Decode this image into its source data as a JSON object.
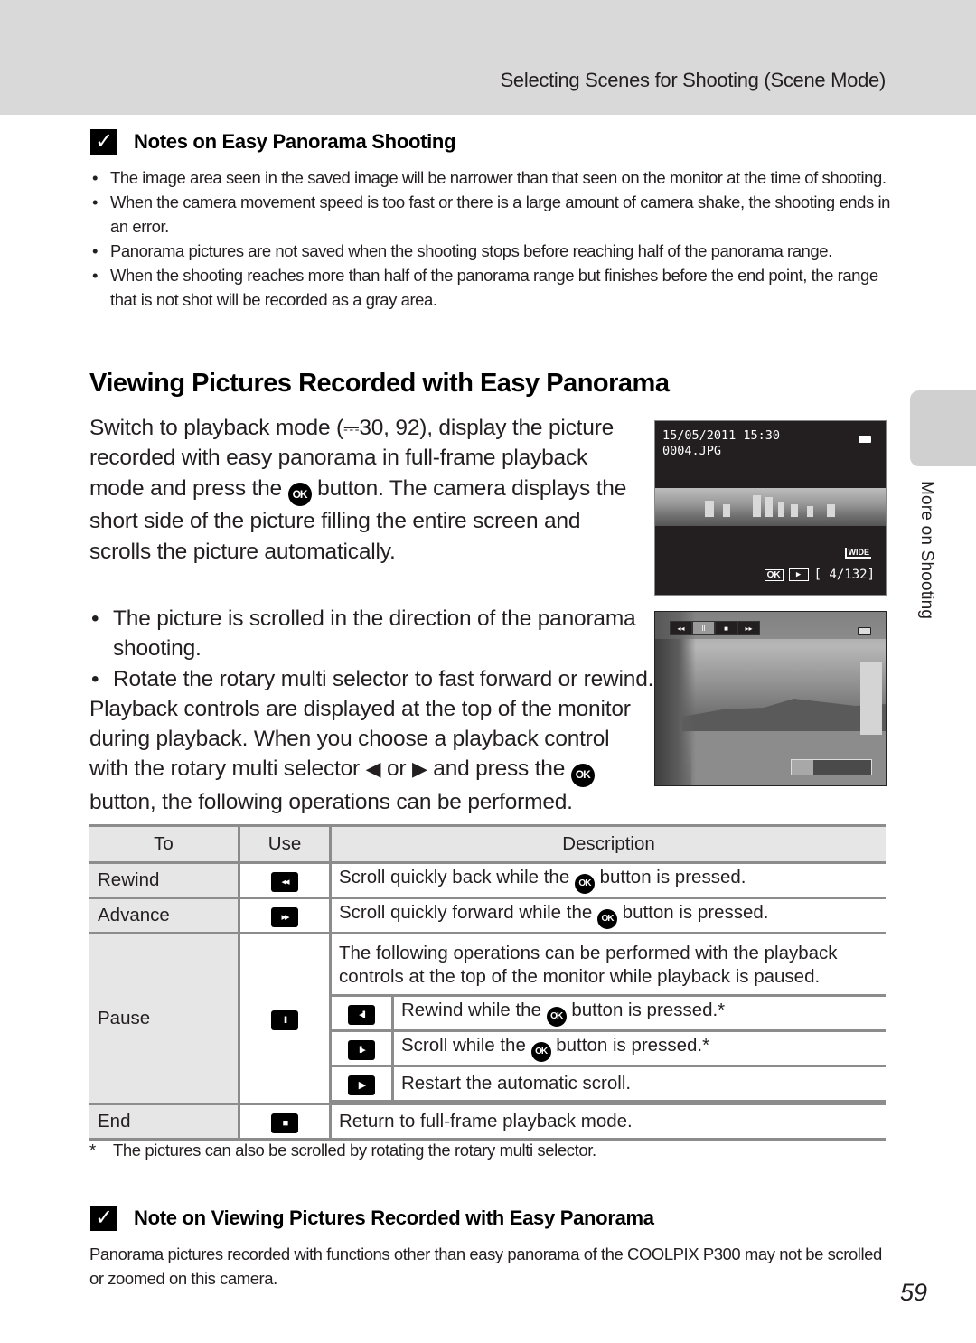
{
  "header": {
    "running_head": "Selecting Scenes for Shooting (Scene Mode)"
  },
  "side_tab": {
    "label": "More on Shooting"
  },
  "notes_shooting": {
    "icon": "check-icon",
    "title": "Notes on Easy Panorama Shooting",
    "bullets": [
      "The image area seen in the saved image will be narrower than that seen on the monitor at the time of shooting.",
      "When the camera movement speed is too fast or there is a large amount of camera shake, the shooting ends in an error.",
      "Panorama pictures are not saved when the shooting stops before reaching half of the panorama range.",
      "When the shooting reaches more than half of the panorama range but finishes before the end point, the range that is not shot will be recorded as a gray area."
    ]
  },
  "section": {
    "title": "Viewing Pictures Recorded with Easy Panorama",
    "intro_part1": "Switch to playback mode (",
    "book_glyph": "⎓",
    "intro_ref": "30, 92), display the picture recorded with easy panorama in full-frame playback mode and press the ",
    "ok_label": "OK",
    "intro_part2": " button. The camera displays the short side of the picture filling the entire screen and scrolls the picture automatically.",
    "bullet1": "The picture is scrolled in the direction of the panorama shooting.",
    "bullet2": "Rotate the rotary multi selector to fast forward or rewind.",
    "para2_a": "Playback controls are displayed at the top of the monitor during playback. When you choose a playback control with the rotary multi selector ",
    "left_arrow": "◀",
    "or": " or ",
    "right_arrow": "▶",
    "para2_b": " and press the ",
    "para2_c": " button, the following operations can be performed."
  },
  "screen1": {
    "datetime": "15/05/2011 15:30",
    "filename": "0004.JPG",
    "wide_label": "WIDE",
    "ok_label": "OK",
    "play_glyph": "▶",
    "counter": "[   4/132]"
  },
  "screen2": {
    "controls": [
      "◂◂",
      "II",
      "■",
      "▸▸"
    ],
    "selected_control": 1,
    "scroll_progress": 0.27
  },
  "table": {
    "headers": [
      "To",
      "Use",
      "Description"
    ],
    "rows": [
      {
        "to": "Rewind",
        "icon": "◂◂",
        "icon_name": "rewind-icon",
        "desc_a": "Scroll quickly back while the ",
        "desc_b": " button is pressed."
      },
      {
        "to": "Advance",
        "icon": "▸▸",
        "icon_name": "fast-forward-icon",
        "desc_a": "Scroll quickly forward while the ",
        "desc_b": " button is pressed."
      }
    ],
    "pause": {
      "to": "Pause",
      "icon": "II",
      "intro": "The following operations can be performed with the playback controls at the top of the monitor while playback is paused.",
      "sub": [
        {
          "icon": "◂II",
          "icon_name": "frame-rewind-icon",
          "desc_a": "Rewind while the ",
          "desc_b": " button is pressed.*"
        },
        {
          "icon": "II▸",
          "icon_name": "frame-advance-icon",
          "desc_a": "Scroll while the ",
          "desc_b": " button is pressed.*"
        },
        {
          "icon": "▶",
          "icon_name": "play-icon",
          "desc_a": "Restart the automatic scroll.",
          "desc_b": ""
        }
      ]
    },
    "end": {
      "to": "End",
      "icon": "■",
      "desc": "Return to full-frame playback mode."
    },
    "ok_label": "OK"
  },
  "footnote": {
    "marker": "*",
    "text": "The pictures can also be scrolled by rotating the rotary multi selector."
  },
  "note_viewing": {
    "icon": "check-icon",
    "title": "Note on Viewing Pictures Recorded with Easy Panorama",
    "text": "Panorama pictures recorded with functions other than easy panorama of the COOLPIX P300 may not be scrolled or zoomed on this camera."
  },
  "page_number": "59"
}
